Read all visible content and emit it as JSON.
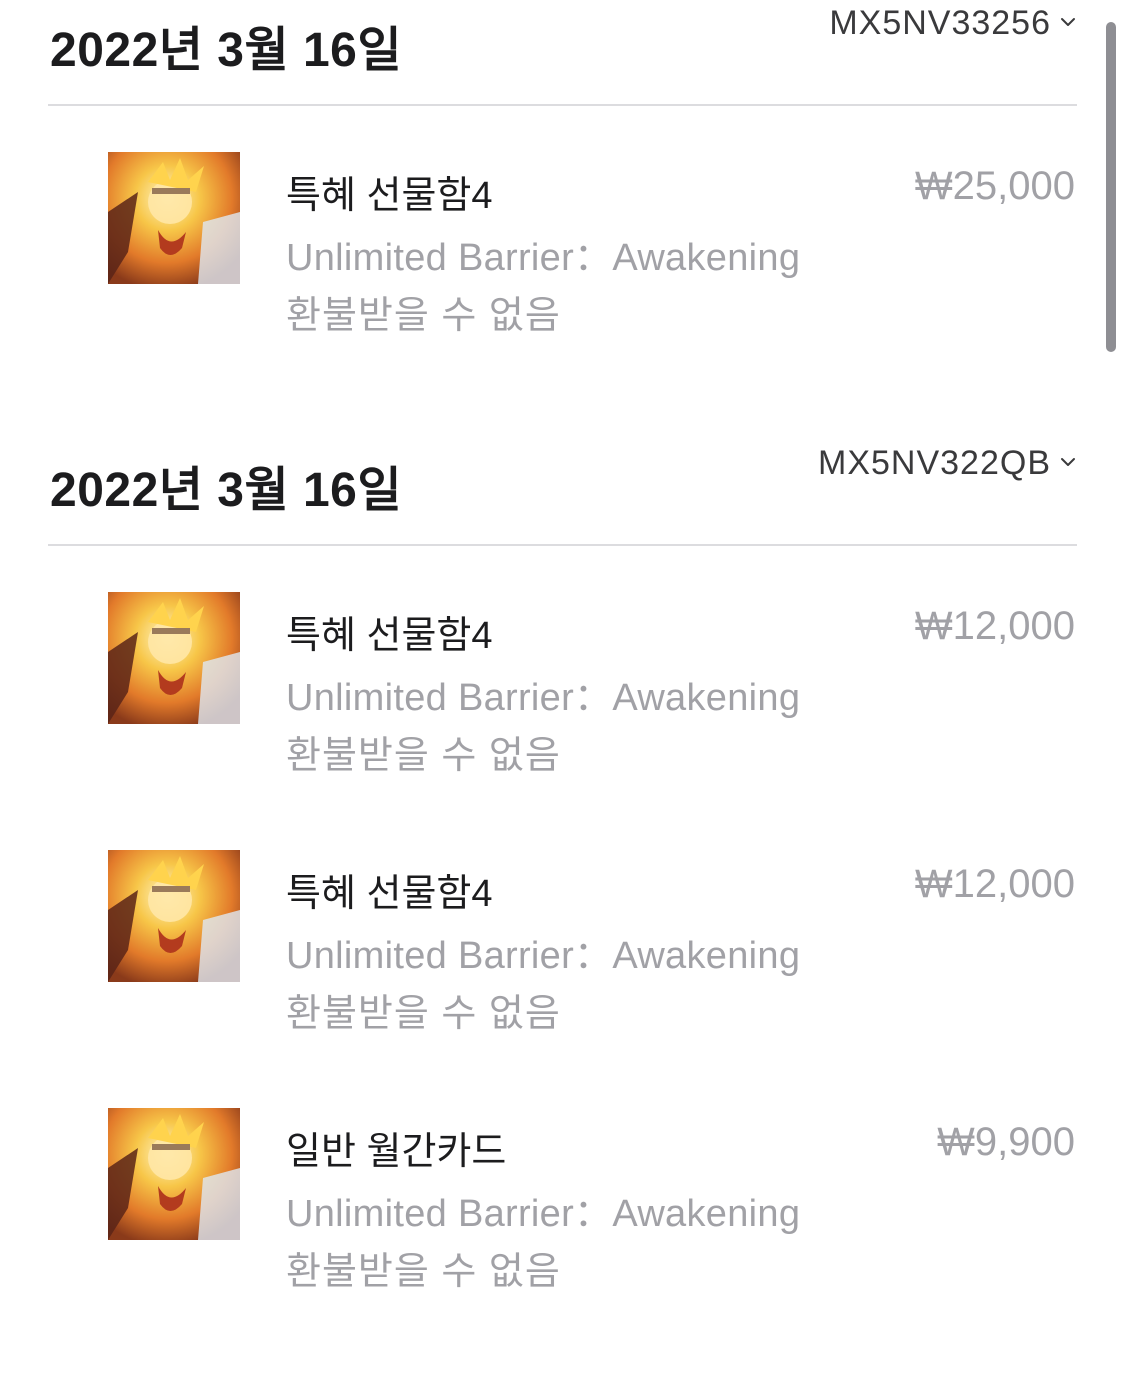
{
  "colors": {
    "title_text": "#1c1c1e",
    "secondary_text": "#a1a1a6",
    "divider": "#dcdcdf",
    "scrollbar": "#8e8e93"
  },
  "sections": [
    {
      "date": "2022년 3월 16일",
      "order_id": "MX5NV33256",
      "items": [
        {
          "title": "특혜 선물함4",
          "app": "Unlimited Barrier：Awakening",
          "note": "환불받을 수 없음",
          "price": "₩25,000",
          "icon": "game-app-icon"
        }
      ]
    },
    {
      "date": "2022년 3월 16일",
      "order_id": "MX5NV322QB",
      "items": [
        {
          "title": "특혜 선물함4",
          "app": "Unlimited Barrier：Awakening",
          "note": "환불받을 수 없음",
          "price": "₩12,000",
          "icon": "game-app-icon"
        },
        {
          "title": "특혜 선물함4",
          "app": "Unlimited Barrier：Awakening",
          "note": "환불받을 수 없음",
          "price": "₩12,000",
          "icon": "game-app-icon"
        },
        {
          "title": "일반 월간카드",
          "app": "Unlimited Barrier：Awakening",
          "note": "환불받을 수 없음",
          "price": "₩9,900",
          "icon": "game-app-icon"
        }
      ]
    }
  ]
}
